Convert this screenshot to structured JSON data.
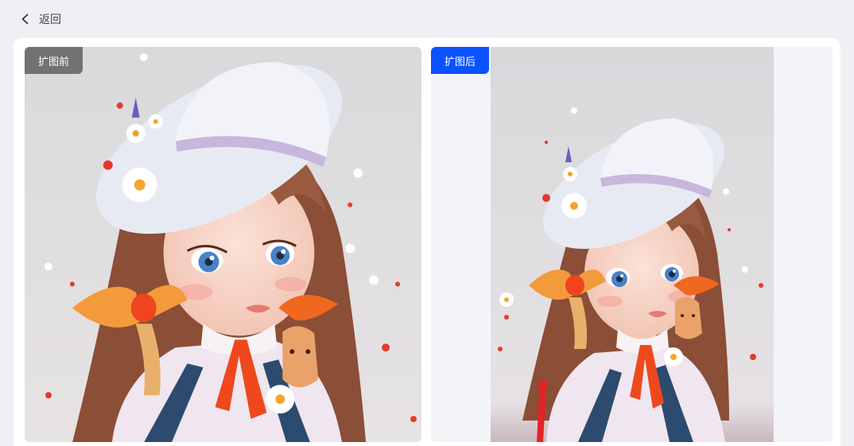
{
  "header": {
    "back_label": "返回",
    "back_icon": "chevron-left-icon"
  },
  "comparison": {
    "before_label": "扩图前",
    "after_label": "扩图后",
    "before_image": "original-illustration-girl-with-hat",
    "after_image": "expanded-illustration-girl-with-hat"
  },
  "colors": {
    "page_bg": "#eef0f4",
    "card_bg": "#ffffff",
    "after_tag": "#0a52ff",
    "before_tag": "#5f5f5f",
    "expanded_area": "#f3f4f7"
  }
}
